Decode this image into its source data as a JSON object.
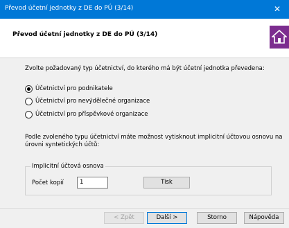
{
  "window": {
    "title": "Převod účetní jednotky z DE do PÚ (3/14)",
    "close_glyph": "✕"
  },
  "header": {
    "title": "Převod účetní jednotky z DE do PÚ (3/14)",
    "logo_icon": "home-icon",
    "logo_color": "#7c2d8f"
  },
  "prompt": "Zvolte požadovaný typ účetnictví, do kterého má být účetní jednotka převedena:",
  "options": [
    {
      "label": "Účetnictví pro podnikatele",
      "selected": true
    },
    {
      "label": "Účetnictví pro nevýdělečné organizace",
      "selected": false
    },
    {
      "label": "Účetnictví pro příspěvkové organizace",
      "selected": false
    }
  ],
  "info_text_1": "Podle zvoleného typu účetnictví máte možnost vytisknout implicitní účtovou osnovu na",
  "info_text_2": "úrovni syntetických účtů:",
  "group": {
    "title": "Implicitní účtová osnova",
    "copies_label": "Počet kopií",
    "copies_value": "1",
    "print_button": "Tisk"
  },
  "footer": {
    "back": "< Zpět",
    "next": "Další >",
    "cancel": "Storno",
    "help": "Nápověda"
  }
}
